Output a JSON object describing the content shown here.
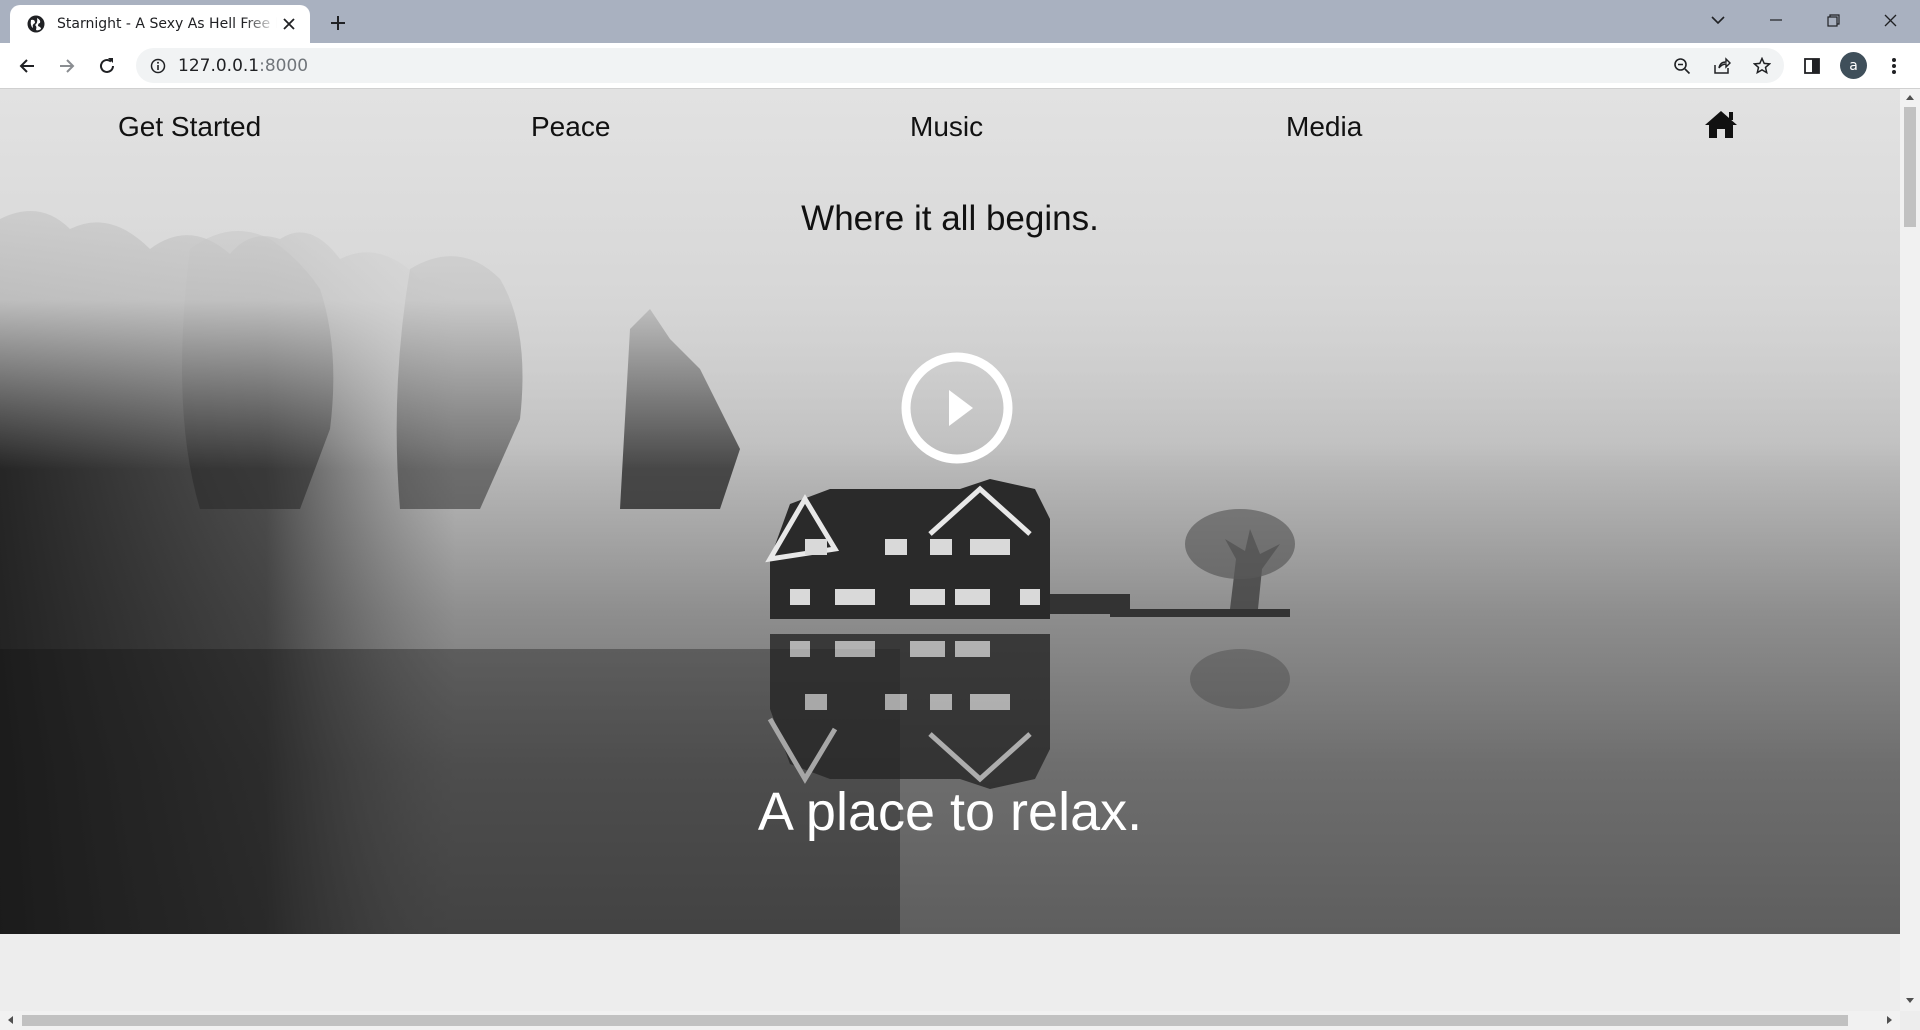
{
  "browser": {
    "tab_title": "Starnight - A Sexy As Hell Free H",
    "url_host": "127.0.0.1",
    "url_port": ":8000",
    "profile_initial": "a",
    "icons": {
      "favicon": "globe-icon",
      "close": "close-icon",
      "new_tab": "plus-icon",
      "back": "back-arrow-icon",
      "forward": "forward-arrow-icon",
      "reload": "reload-icon",
      "info": "info-icon",
      "zoom": "zoom-out-icon",
      "share": "share-icon",
      "bookmark": "star-icon",
      "sidebar": "side-panel-icon",
      "menu": "kebab-menu-icon"
    }
  },
  "site": {
    "nav": {
      "items": [
        {
          "label": "Get Started"
        },
        {
          "label": "Peace"
        },
        {
          "label": "Music"
        },
        {
          "label": "Media"
        }
      ],
      "home_icon": "home-icon"
    },
    "tagline": "Where it all begins.",
    "play_icon": "play-circle-icon",
    "headline": "A place to relax."
  },
  "colors": {
    "tab_strip": "#a9b1c0",
    "nav_text": "#111111",
    "headline_text": "#ffffff"
  }
}
